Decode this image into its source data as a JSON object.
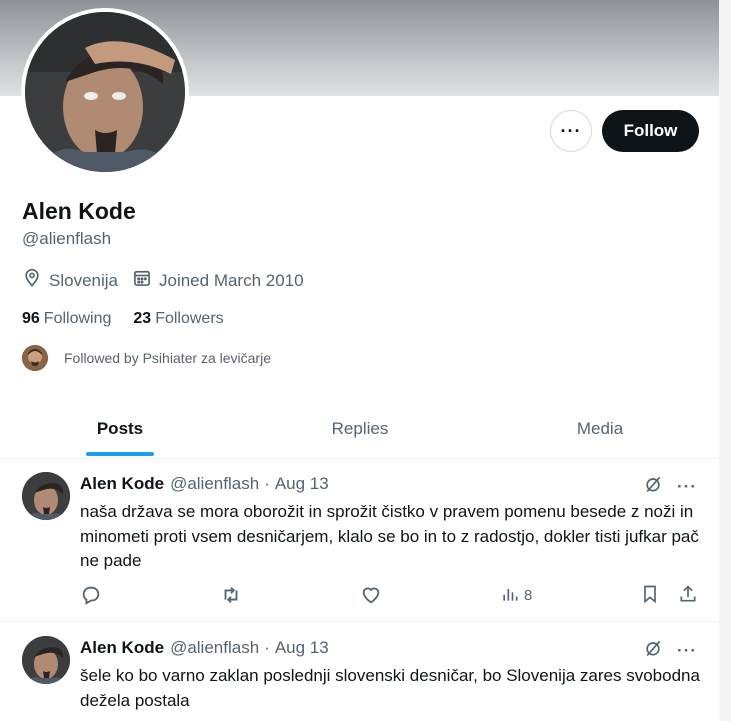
{
  "profile": {
    "name": "Alen Kode",
    "handle": "@alienflash",
    "location": "Slovenija",
    "joined": "Joined March 2010",
    "following_count": "96",
    "following_label": "Following",
    "followers_count": "23",
    "followers_label": "Followers",
    "followed_by": "Followed by Psihiater za levičarje",
    "follow_label": "Follow",
    "more_label": "···"
  },
  "tabs": [
    {
      "label": "Posts",
      "active": true
    },
    {
      "label": "Replies",
      "active": false
    },
    {
      "label": "Media",
      "active": false
    }
  ],
  "tweets": [
    {
      "name": "Alen Kode",
      "handle": "@alienflash",
      "separator": "·",
      "date": "Aug 13",
      "text": "naša država se mora oborožit in sprožit čistko v pravem pomenu besede z noži in minometi proti vsem desničarjem, klalo se bo in to z radostjo, dokler tisti jufkar pač ne pade",
      "views": "8",
      "more": "···"
    },
    {
      "name": "Alen Kode",
      "handle": "@alienflash",
      "separator": "·",
      "date": "Aug 13",
      "text": "šele ko bo varno zaklan poslednji slovenski desničar, bo Slovenija zares svobodna dežela postala",
      "more": "···"
    }
  ],
  "colors": {
    "accent": "#1d9bf0",
    "text": "#0f1419",
    "muted": "#536471",
    "border": "#eff3f4"
  }
}
